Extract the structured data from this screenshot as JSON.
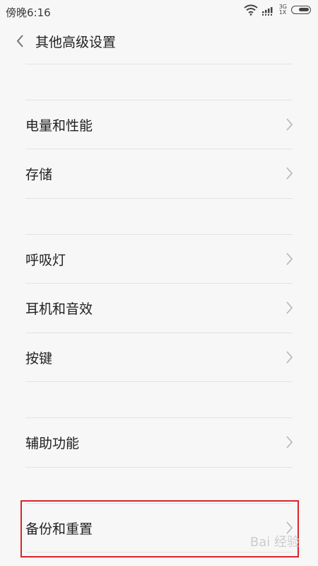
{
  "status_bar": {
    "time": "傍晚6:16",
    "network_top": "3G",
    "network_bottom": "1X",
    "icons": [
      "wifi-icon",
      "signal-icon",
      "battery-icon"
    ]
  },
  "header": {
    "title": "其他高级设置",
    "back_icon": "chevron-left-icon"
  },
  "items": [
    {
      "label": "电量和性能"
    },
    {
      "label": "存储"
    },
    {
      "label": "呼吸灯"
    },
    {
      "label": "耳机和音效"
    },
    {
      "label": "按键"
    },
    {
      "label": "辅助功能"
    },
    {
      "label": "备份和重置"
    }
  ],
  "highlight": {
    "color": "#d9252b",
    "target": "备份和重置"
  },
  "watermark": {
    "text": "Bai 经验"
  }
}
